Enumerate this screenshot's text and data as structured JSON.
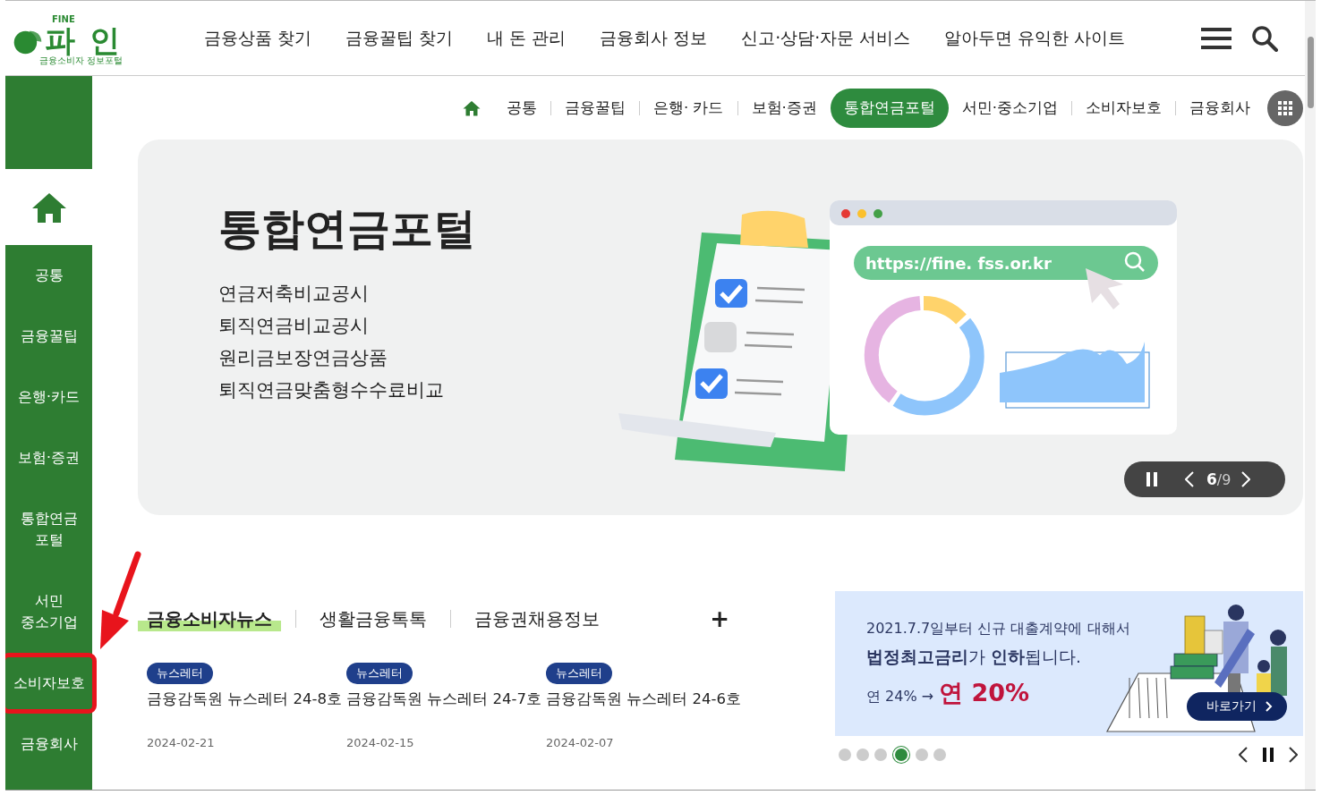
{
  "logo": {
    "small": "FINE",
    "name": "파 인",
    "tagline": "금융소비자 정보포털"
  },
  "nav": [
    "금융상품 찾기",
    "금융꿀팁 찾기",
    "내 돈 관리",
    "금융회사 정보",
    "신고·상담·자문 서비스",
    "알아두면 유익한 사이트"
  ],
  "sidebar": {
    "items": [
      {
        "label": "공통",
        "highlighted": false
      },
      {
        "label": "금융꿀팁",
        "highlighted": false
      },
      {
        "label": "은행·카드",
        "highlighted": false
      },
      {
        "label": "보험·증권",
        "highlighted": false
      },
      {
        "label": "통합연금\n포털",
        "highlighted": false
      },
      {
        "label": "서민\n중소기업",
        "highlighted": false
      },
      {
        "label": "소비자보호",
        "highlighted": true
      },
      {
        "label": "금융회사",
        "highlighted": false
      }
    ]
  },
  "arrow_annotation": true,
  "categories": [
    {
      "label": "공통",
      "selected": false
    },
    {
      "label": "금융꿀팁",
      "selected": false
    },
    {
      "label": "은행· 카드",
      "selected": false
    },
    {
      "label": "보험·증권",
      "selected": false
    },
    {
      "label": "통합연금포털",
      "selected": true
    },
    {
      "label": "서민·중소기업",
      "selected": false
    },
    {
      "label": "소비자보호",
      "selected": false
    },
    {
      "label": "금융회사",
      "selected": false
    }
  ],
  "hero": {
    "title": "통합연금포털",
    "links": [
      "연금저축비교공시",
      "퇴직연금비교공시",
      "원리금보장연금상품",
      "퇴직연금맞춤형수수료비교"
    ],
    "url": "https://fine. fss.or.kr",
    "current": "6",
    "total": "/9",
    "paused": false
  },
  "news": {
    "tabs": [
      {
        "label": "금융소비자뉴스",
        "selected": true
      },
      {
        "label": "생활금융톡톡",
        "selected": false
      },
      {
        "label": "금융권채용정보",
        "selected": false
      }
    ],
    "more": "+",
    "items": [
      {
        "badge": "뉴스레터",
        "title": "금융감독원 뉴스레터 24-8호",
        "date": "2024-02-21"
      },
      {
        "badge": "뉴스레터",
        "title": "금융감독원 뉴스레터 24-7호",
        "date": "2024-02-15"
      },
      {
        "badge": "뉴스레터",
        "title": "금융감독원 뉴스레터 24-6호",
        "date": "2024-02-07"
      }
    ]
  },
  "promo": {
    "line1": "2021.7.7일부터 신규 대출계약에 대해서",
    "line2": "**법정최고금리**가 **인하**됩니다.",
    "rate_from": "연 24% →",
    "rate_to": "연 20%",
    "button": "바로가기",
    "dots": [
      {
        "selected": false
      },
      {
        "selected": false
      },
      {
        "selected": false
      },
      {
        "selected": true
      },
      {
        "selected": false
      },
      {
        "selected": false
      }
    ],
    "paused": false
  }
}
